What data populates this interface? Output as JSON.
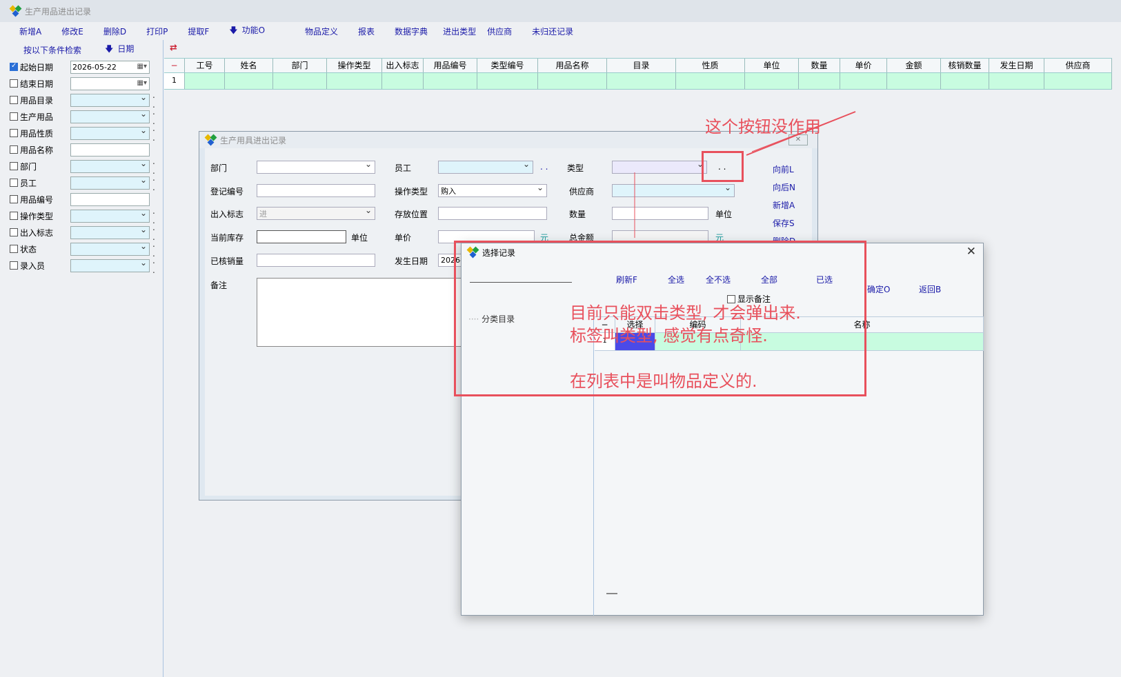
{
  "window": {
    "title": "生产用品进出记录"
  },
  "menu": [
    "新增A",
    "修改E",
    "删除D",
    "打印P",
    "提取F",
    "功能O",
    "物品定义",
    "报表",
    "数据字典",
    "进出类型",
    "供应商",
    "未归还记录"
  ],
  "left_panel": {
    "search_label": "按以下条件检索",
    "sort_label": "日期",
    "filters": [
      {
        "label": "起始日期",
        "checked": true,
        "value": "2026-05-22",
        "kind": "date"
      },
      {
        "label": "结束日期",
        "checked": false,
        "value": "",
        "kind": "date"
      },
      {
        "label": "用品目录",
        "checked": false,
        "value": "",
        "kind": "combo"
      },
      {
        "label": "生产用品",
        "checked": false,
        "value": "",
        "kind": "combo"
      },
      {
        "label": "用品性质",
        "checked": false,
        "value": "",
        "kind": "combo"
      },
      {
        "label": "用品名称",
        "checked": false,
        "value": "",
        "kind": "text"
      },
      {
        "label": "部门",
        "checked": false,
        "value": "",
        "kind": "combo"
      },
      {
        "label": "员工",
        "checked": false,
        "value": "",
        "kind": "combo"
      },
      {
        "label": "用品编号",
        "checked": false,
        "value": "",
        "kind": "text"
      },
      {
        "label": "操作类型",
        "checked": false,
        "value": "",
        "kind": "combo"
      },
      {
        "label": "出入标志",
        "checked": false,
        "value": "",
        "kind": "combo"
      },
      {
        "label": "状态",
        "checked": false,
        "value": "",
        "kind": "combo"
      },
      {
        "label": "录入员",
        "checked": false,
        "value": "",
        "kind": "combo"
      }
    ],
    "dots": ". ."
  },
  "main_grid": {
    "row_marker": "−",
    "columns": [
      "工号",
      "姓名",
      "部门",
      "操作类型",
      "出入标志",
      "用品编号",
      "类型编号",
      "用品名称",
      "目录",
      "性质",
      "单位",
      "数量",
      "单价",
      "金额",
      "核销数量",
      "发生日期",
      "供应商"
    ],
    "row_number": "1"
  },
  "edit_dialog": {
    "title": "生产用具进出记录",
    "close": "✕",
    "labels": {
      "dept": "部门",
      "employee": "员工",
      "type": "类型",
      "reg_no": "登记编号",
      "op_type": "操作类型",
      "supplier": "供应商",
      "io_flag": "出入标志",
      "location": "存放位置",
      "qty": "数量",
      "unit1": "单位",
      "stock": "当前库存",
      "unit2": "单位",
      "price": "单价",
      "total": "总金额",
      "written_off": "已核销量",
      "date": "发生日期",
      "remark": "备注",
      "yuan1": "元",
      "yuan2": "元"
    },
    "values": {
      "op_type": "购入",
      "io_flag": "进",
      "date": "2026-0"
    },
    "dots": ". .",
    "side_buttons": [
      "向前L",
      "向后N",
      "新增A",
      "保存S",
      "删除D"
    ]
  },
  "select_dialog": {
    "title": "选择记录",
    "close": "✕",
    "toolbar": [
      "刷新F",
      "全选",
      "全不选",
      "全部",
      "已选"
    ],
    "ok": "确定O",
    "back": "返回B",
    "show_remark": "显示备注",
    "tree_root": "分类目录",
    "grid": {
      "marker": "−",
      "columns": [
        "选择",
        "编码",
        "名称"
      ],
      "row_number": "1"
    }
  },
  "annotations": {
    "note1": "这个按钮没作用",
    "note2_line1": "目前只能双击类型, 才会弹出来.",
    "note2_line2": "标签叫类型, 感觉有点奇怪.",
    "note2_line3": "在列表中是叫物品定义的.",
    "color": "#e8505c"
  }
}
